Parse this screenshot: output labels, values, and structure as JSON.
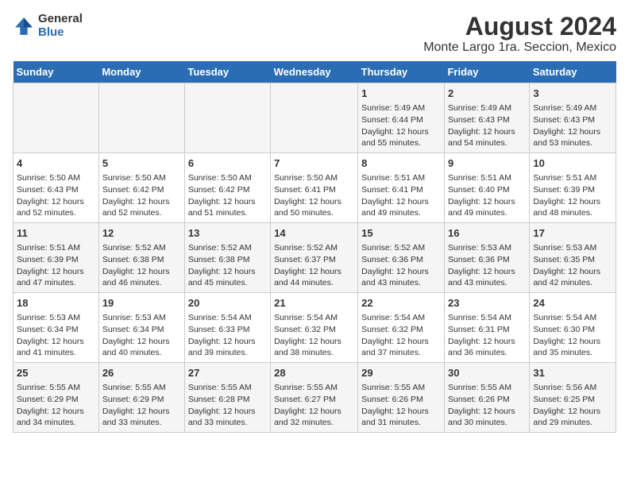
{
  "logo": {
    "general": "General",
    "blue": "Blue"
  },
  "title": "August 2024",
  "subtitle": "Monte Largo 1ra. Seccion, Mexico",
  "days_of_week": [
    "Sunday",
    "Monday",
    "Tuesday",
    "Wednesday",
    "Thursday",
    "Friday",
    "Saturday"
  ],
  "weeks": [
    [
      {
        "day": "",
        "content": ""
      },
      {
        "day": "",
        "content": ""
      },
      {
        "day": "",
        "content": ""
      },
      {
        "day": "",
        "content": ""
      },
      {
        "day": "1",
        "content": "Sunrise: 5:49 AM\nSunset: 6:44 PM\nDaylight: 12 hours and 55 minutes."
      },
      {
        "day": "2",
        "content": "Sunrise: 5:49 AM\nSunset: 6:43 PM\nDaylight: 12 hours and 54 minutes."
      },
      {
        "day": "3",
        "content": "Sunrise: 5:49 AM\nSunset: 6:43 PM\nDaylight: 12 hours and 53 minutes."
      }
    ],
    [
      {
        "day": "4",
        "content": "Sunrise: 5:50 AM\nSunset: 6:43 PM\nDaylight: 12 hours and 52 minutes."
      },
      {
        "day": "5",
        "content": "Sunrise: 5:50 AM\nSunset: 6:42 PM\nDaylight: 12 hours and 52 minutes."
      },
      {
        "day": "6",
        "content": "Sunrise: 5:50 AM\nSunset: 6:42 PM\nDaylight: 12 hours and 51 minutes."
      },
      {
        "day": "7",
        "content": "Sunrise: 5:50 AM\nSunset: 6:41 PM\nDaylight: 12 hours and 50 minutes."
      },
      {
        "day": "8",
        "content": "Sunrise: 5:51 AM\nSunset: 6:41 PM\nDaylight: 12 hours and 49 minutes."
      },
      {
        "day": "9",
        "content": "Sunrise: 5:51 AM\nSunset: 6:40 PM\nDaylight: 12 hours and 49 minutes."
      },
      {
        "day": "10",
        "content": "Sunrise: 5:51 AM\nSunset: 6:39 PM\nDaylight: 12 hours and 48 minutes."
      }
    ],
    [
      {
        "day": "11",
        "content": "Sunrise: 5:51 AM\nSunset: 6:39 PM\nDaylight: 12 hours and 47 minutes."
      },
      {
        "day": "12",
        "content": "Sunrise: 5:52 AM\nSunset: 6:38 PM\nDaylight: 12 hours and 46 minutes."
      },
      {
        "day": "13",
        "content": "Sunrise: 5:52 AM\nSunset: 6:38 PM\nDaylight: 12 hours and 45 minutes."
      },
      {
        "day": "14",
        "content": "Sunrise: 5:52 AM\nSunset: 6:37 PM\nDaylight: 12 hours and 44 minutes."
      },
      {
        "day": "15",
        "content": "Sunrise: 5:52 AM\nSunset: 6:36 PM\nDaylight: 12 hours and 43 minutes."
      },
      {
        "day": "16",
        "content": "Sunrise: 5:53 AM\nSunset: 6:36 PM\nDaylight: 12 hours and 43 minutes."
      },
      {
        "day": "17",
        "content": "Sunrise: 5:53 AM\nSunset: 6:35 PM\nDaylight: 12 hours and 42 minutes."
      }
    ],
    [
      {
        "day": "18",
        "content": "Sunrise: 5:53 AM\nSunset: 6:34 PM\nDaylight: 12 hours and 41 minutes."
      },
      {
        "day": "19",
        "content": "Sunrise: 5:53 AM\nSunset: 6:34 PM\nDaylight: 12 hours and 40 minutes."
      },
      {
        "day": "20",
        "content": "Sunrise: 5:54 AM\nSunset: 6:33 PM\nDaylight: 12 hours and 39 minutes."
      },
      {
        "day": "21",
        "content": "Sunrise: 5:54 AM\nSunset: 6:32 PM\nDaylight: 12 hours and 38 minutes."
      },
      {
        "day": "22",
        "content": "Sunrise: 5:54 AM\nSunset: 6:32 PM\nDaylight: 12 hours and 37 minutes."
      },
      {
        "day": "23",
        "content": "Sunrise: 5:54 AM\nSunset: 6:31 PM\nDaylight: 12 hours and 36 minutes."
      },
      {
        "day": "24",
        "content": "Sunrise: 5:54 AM\nSunset: 6:30 PM\nDaylight: 12 hours and 35 minutes."
      }
    ],
    [
      {
        "day": "25",
        "content": "Sunrise: 5:55 AM\nSunset: 6:29 PM\nDaylight: 12 hours and 34 minutes."
      },
      {
        "day": "26",
        "content": "Sunrise: 5:55 AM\nSunset: 6:29 PM\nDaylight: 12 hours and 33 minutes."
      },
      {
        "day": "27",
        "content": "Sunrise: 5:55 AM\nSunset: 6:28 PM\nDaylight: 12 hours and 33 minutes."
      },
      {
        "day": "28",
        "content": "Sunrise: 5:55 AM\nSunset: 6:27 PM\nDaylight: 12 hours and 32 minutes."
      },
      {
        "day": "29",
        "content": "Sunrise: 5:55 AM\nSunset: 6:26 PM\nDaylight: 12 hours and 31 minutes."
      },
      {
        "day": "30",
        "content": "Sunrise: 5:55 AM\nSunset: 6:26 PM\nDaylight: 12 hours and 30 minutes."
      },
      {
        "day": "31",
        "content": "Sunrise: 5:56 AM\nSunset: 6:25 PM\nDaylight: 12 hours and 29 minutes."
      }
    ]
  ]
}
